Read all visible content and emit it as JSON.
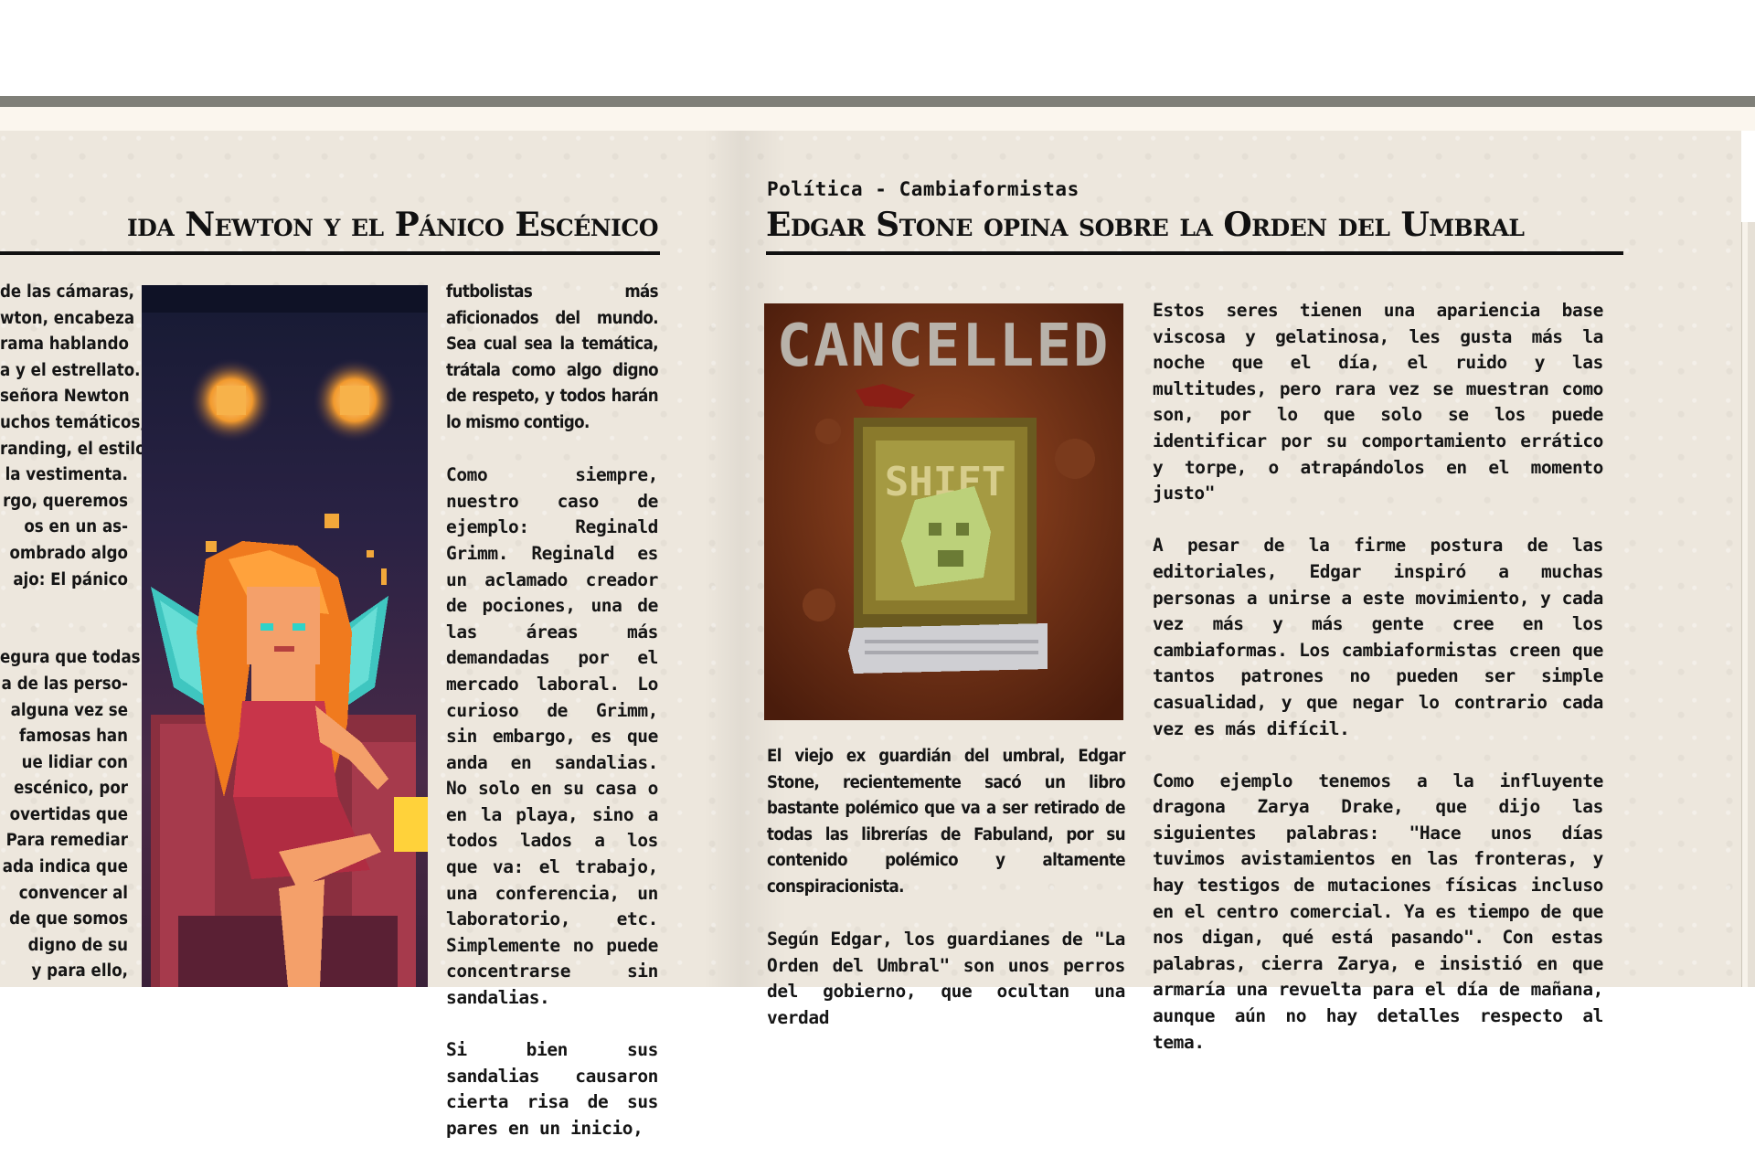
{
  "left_article": {
    "headline": "ida Newton y el Pánico Escénico",
    "col1": [
      "de las cámaras,",
      "wton, encabeza",
      "rama hablando",
      "a y el estrellato.",
      "señora Newton",
      "uchos temáticos,",
      "randing, el estilo",
      "la vestimenta.",
      "rgo, queremos",
      "os en un as-",
      "ombrado algo",
      "ajo: El pánico",
      "",
      "",
      "egura que todas",
      "a de las perso-",
      "alguna vez se",
      "famosas han",
      "ue lidiar con",
      "escénico, por",
      "overtidas que",
      "Para remediar",
      "ada indica que",
      "convencer al",
      "de que somos",
      "digno de su",
      "y para ello,"
    ],
    "col2_p1": "futbolistas más aficionados del mundo. Sea cual sea la temática, trátala como algo digno de respeto, y todos harán lo mismo contigo.",
    "col2_p2": "Como siempre, nuestro caso de ejemplo: Reginald Grimm. Reginald es un aclamado creador de pociones, una de las áreas más demandadas por el mercado laboral. Lo curioso de Grimm, sin embargo, es que anda en sandalias. No solo en su casa o en la playa, sino a todos lados a los que va: el trabajo, una conferencia, un laboratorio, etc. Simplemente no puede concentrarse sin sandalias.",
    "col2_p3": "Si bien sus sandalias causaron cierta risa de sus pares en un inicio,"
  },
  "right_article": {
    "section": "Política - Cambiaformistas",
    "headline": "Edgar Stone opina sobre la Orden del Umbral",
    "image_text": "CANCELLED",
    "book_title": "SHIFT",
    "col1_p1": "El viejo ex guardián del umbral, Edgar Stone, recientemente sacó un libro bastante polémico que va a ser retirado de todas las librerías de Fabuland, por su contenido polémico y altamente conspiracionista.",
    "col1_p2": "Según Edgar, los guardianes de \"La Orden del Umbral\" son unos perros del gobierno, que ocultan una verdad",
    "col2_p1": "Estos seres tienen una apariencia base viscosa y gelatinosa, les gusta más la noche que el día, el ruido y las multitudes, pero rara vez se muestran como son, por lo que solo se los puede identificar por su comportamiento errático y torpe, o atrapándolos en el momento justo\"",
    "col2_p2": "A pesar de la firme postura de las editoriales, Edgar inspiró a muchas personas a unirse a este movimiento, y cada vez más y más gente cree en los cambiaformas. Los cambiaformistas creen que tantos patrones no pueden ser simple casualidad, y que negar lo contrario cada vez es más difícil.",
    "col2_p3": "Como ejemplo tenemos a la influyente dragona Zarya Drake, que dijo las siguientes palabras: \"Hace unos días tuvimos avistamientos en las fronteras, y hay testigos de mutaciones físicas incluso en el centro comercial. Ya es tiempo de que nos digan, qué está pasando\". Con estas palabras, cierra Zarya, e insistió en que armaría una revuelta para el día de mañana, aunque aún no hay detalles respecto al tema."
  },
  "colors": {
    "paper": "#ede7dd",
    "ink": "#111111",
    "top_bar": "#7f7f78"
  }
}
